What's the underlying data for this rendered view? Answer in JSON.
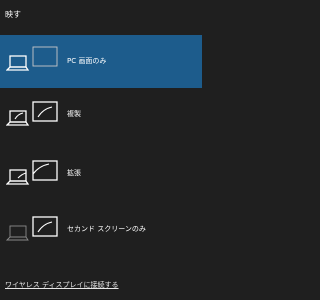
{
  "panel": {
    "title": "映す"
  },
  "options": [
    {
      "label": "PC 画面のみ",
      "icon": "pc-screen-only-icon",
      "selected": true
    },
    {
      "label": "複製",
      "icon": "duplicate-icon",
      "selected": false
    },
    {
      "label": "拡張",
      "icon": "extend-icon",
      "selected": false
    },
    {
      "label": "セカンド スクリーンのみ",
      "icon": "second-screen-only-icon",
      "selected": false
    }
  ],
  "footer": {
    "wireless_link": "ワイヤレス ディスプレイに接続する"
  },
  "colors": {
    "background": "#1f1f1f",
    "selected": "#1d5c8c"
  }
}
